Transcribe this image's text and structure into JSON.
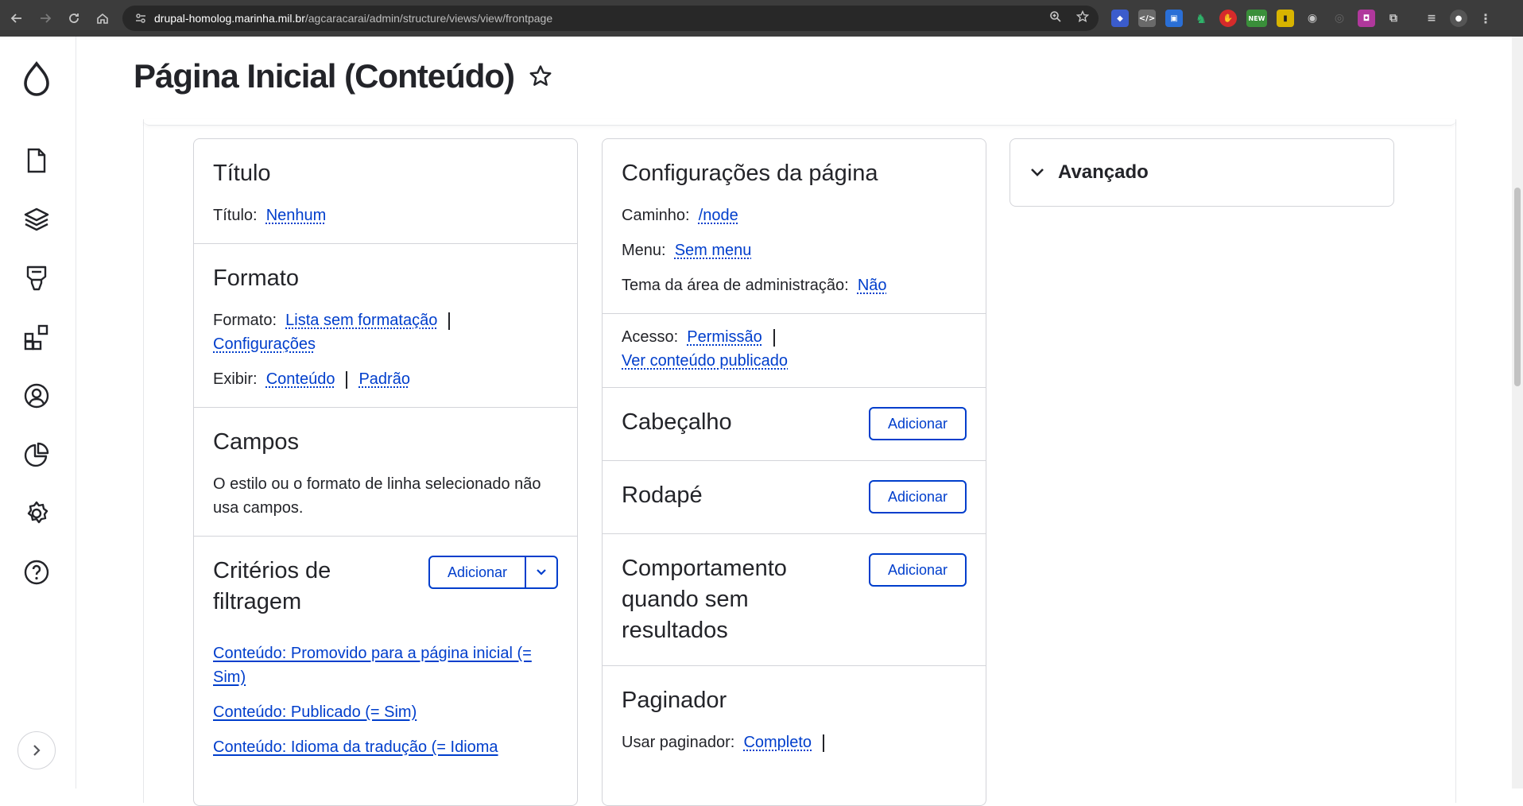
{
  "browser": {
    "url_host": "drupal-homolog.marinha.mil.br",
    "url_path": "/agcaracarai/admin/structure/views/view/frontpage",
    "ext_new_badge": "NEW"
  },
  "colors": {
    "accent": "#003ecc",
    "text": "#232429",
    "border": "#d3d4d9"
  },
  "sidebar": {
    "icons": [
      "drupal-logo-icon",
      "content-icon",
      "structure-icon",
      "appearance-icon",
      "extend-icon",
      "people-icon",
      "reports-icon",
      "configuration-icon",
      "help-icon"
    ]
  },
  "page": {
    "title": "Página Inicial (Conteúdo)"
  },
  "col1": {
    "titulo": {
      "heading": "Título",
      "label": "Título:",
      "value": "Nenhum"
    },
    "formato": {
      "heading": "Formato",
      "format_label": "Formato:",
      "format_value": "Lista sem formatação",
      "settings": "Configurações",
      "show_label": "Exibir:",
      "show_value": "Conteúdo",
      "show_default": "Padrão"
    },
    "campos": {
      "heading": "Campos",
      "text": "O estilo ou o formato de linha selecionado não usa campos."
    },
    "filtros": {
      "heading": "Critérios de filtragem",
      "add": "Adicionar",
      "items": [
        "Conteúdo: Promovido para a página inicial (= Sim)",
        "Conteúdo: Publicado (= Sim)",
        "Conteúdo: Idioma da tradução (= Idioma"
      ]
    }
  },
  "col2": {
    "config": {
      "heading": "Configurações da página",
      "path_label": "Caminho:",
      "path_value": "/node",
      "menu_label": "Menu:",
      "menu_value": "Sem menu",
      "theme_label": "Tema da área de administração:",
      "theme_value": "Não"
    },
    "acesso": {
      "label": "Acesso:",
      "value": "Permissão",
      "extra": "Ver conteúdo publicado"
    },
    "cabecalho": {
      "heading": "Cabeçalho",
      "add": "Adicionar"
    },
    "rodape": {
      "heading": "Rodapé",
      "add": "Adicionar"
    },
    "sem_resultados": {
      "heading": "Comportamento quando sem resultados",
      "add": "Adicionar"
    },
    "paginador": {
      "heading": "Paginador",
      "label": "Usar paginador:",
      "value": "Completo"
    }
  },
  "col3": {
    "avancado": "Avançado"
  }
}
